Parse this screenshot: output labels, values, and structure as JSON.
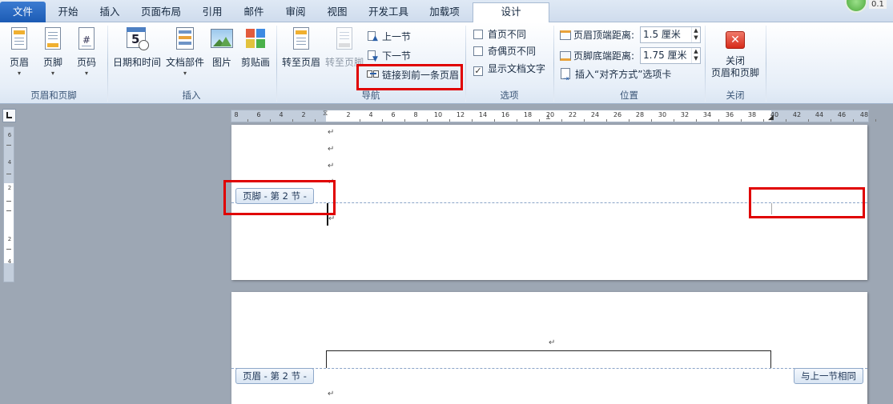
{
  "tabs": [
    {
      "label": "文件"
    },
    {
      "label": "开始"
    },
    {
      "label": "插入"
    },
    {
      "label": "页面布局"
    },
    {
      "label": "引用"
    },
    {
      "label": "邮件"
    },
    {
      "label": "审阅"
    },
    {
      "label": "视图"
    },
    {
      "label": "开发工具"
    },
    {
      "label": "加载项"
    },
    {
      "label": "设计"
    }
  ],
  "status_text": "0.1",
  "groups": {
    "header_footer": {
      "label": "页眉和页脚",
      "buttons": [
        {
          "label": "页眉"
        },
        {
          "label": "页脚"
        },
        {
          "label": "页码"
        }
      ]
    },
    "insert": {
      "label": "插入",
      "buttons": [
        {
          "label": "日期和时间"
        },
        {
          "label": "文档部件"
        },
        {
          "label": "图片"
        },
        {
          "label": "剪贴画"
        }
      ]
    },
    "navigation": {
      "label": "导航",
      "goto_header": "转至页眉",
      "goto_footer": "转至页脚",
      "previous": "上一节",
      "next": "下一节",
      "link_previous": "链接到前一条页眉"
    },
    "options": {
      "label": "选项",
      "first_page": {
        "label": "首页不同",
        "checked": false
      },
      "odd_even": {
        "label": "奇偶页不同",
        "checked": false
      },
      "show_text": {
        "label": "显示文档文字",
        "checked": true
      }
    },
    "position": {
      "label": "位置",
      "header_top_label": "页眉顶端距离:",
      "header_top_value": "1.5 厘米",
      "footer_bottom_label": "页脚底端距离:",
      "footer_bottom_value": "1.75 厘米",
      "align_tab": "插入“对齐方式”选项卡"
    },
    "close": {
      "label": "关闭",
      "button_line1": "关闭",
      "button_line2": "页眉和页脚"
    }
  },
  "ruler": {
    "numbers": [
      "8",
      "6",
      "4",
      "2",
      "2",
      "4",
      "6",
      "8",
      "10",
      "12",
      "14",
      "16",
      "18",
      "20",
      "22",
      "24",
      "26",
      "28",
      "30",
      "32",
      "34",
      "36",
      "38",
      "40",
      "42",
      "44",
      "46",
      "48"
    ],
    "vertical_numbers": [
      "6",
      "4",
      "2",
      "2",
      "4"
    ]
  },
  "document": {
    "paragraph_mark": "↵",
    "footer_tag": "页脚 - 第 2 节 -",
    "header_tag": "页眉 - 第 2 节 -",
    "same_as_previous": "与上一节相同"
  },
  "colors": {
    "accent_red": "#e00000",
    "file_tab": "#2a6ac4",
    "dashed_line": "#8aa4c8"
  }
}
